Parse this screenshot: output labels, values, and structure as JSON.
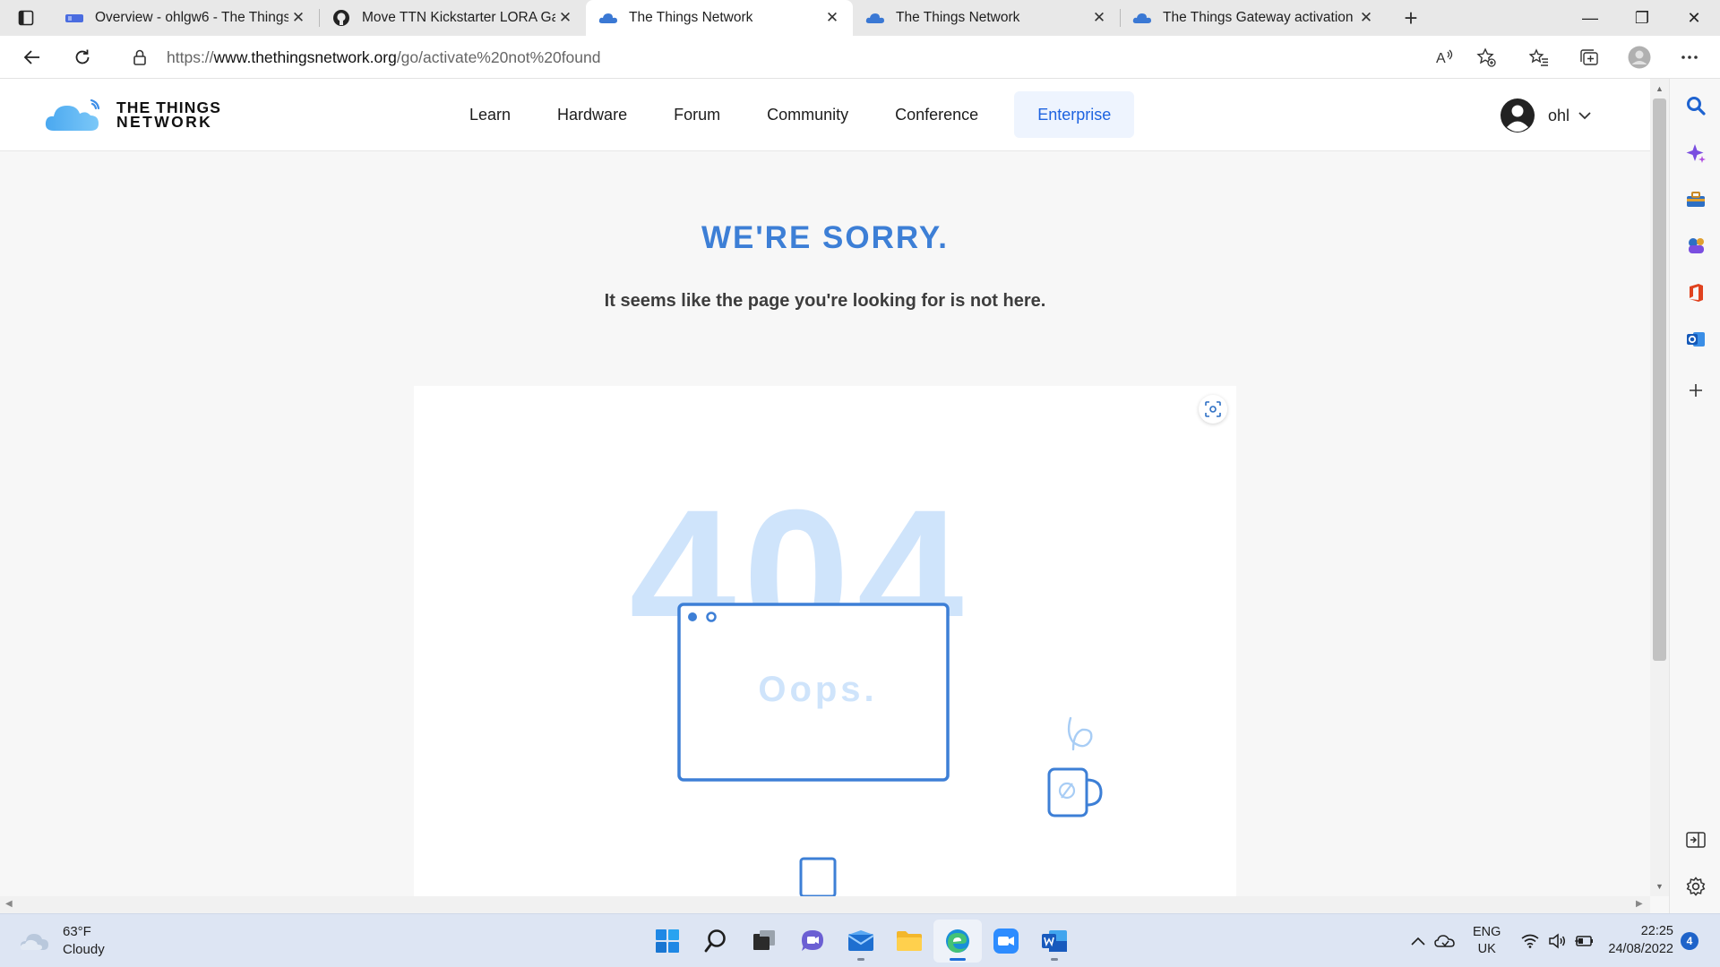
{
  "browser": {
    "tabs": [
      {
        "title": "Overview - ohlgw6 - The Things",
        "favicon": "ttn-gateway-icon",
        "active": false
      },
      {
        "title": "Move TTN Kickstarter LORA Gate",
        "favicon": "github-icon",
        "active": false
      },
      {
        "title": "The Things Network",
        "favicon": "ttn-cloud-icon",
        "active": true
      },
      {
        "title": "The Things Network",
        "favicon": "ttn-cloud-icon",
        "active": false
      },
      {
        "title": "The Things Gateway activation -",
        "favicon": "ttn-cloud-icon",
        "active": false
      }
    ],
    "close_glyph": "✕",
    "new_tab_glyph": "+",
    "window_controls": {
      "minimize": "—",
      "restore": "❐",
      "close": "✕"
    },
    "address": {
      "prefix": "https://",
      "domain": "www.thethingsnetwork.org",
      "path": "/go/activate%20not%20found"
    }
  },
  "site": {
    "logo_line1": "THE THINGS",
    "logo_line2": "NETWORK",
    "nav": [
      "Learn",
      "Hardware",
      "Forum",
      "Community",
      "Conference"
    ],
    "nav_enterprise": "Enterprise",
    "user_name": "ohl",
    "accent_color": "#3d7fd6",
    "enterprise_color": "#1e63e0"
  },
  "error": {
    "title": "WE'RE SORRY.",
    "message": "It seems like the page you're looking for is not here.",
    "big_code": "404",
    "screen_text": "Oops."
  },
  "taskbar": {
    "weather_temp": "63°F",
    "weather_desc": "Cloudy",
    "language": "ENG",
    "region": "UK",
    "time": "22:25",
    "date": "24/08/2022",
    "notification_count": "4"
  }
}
